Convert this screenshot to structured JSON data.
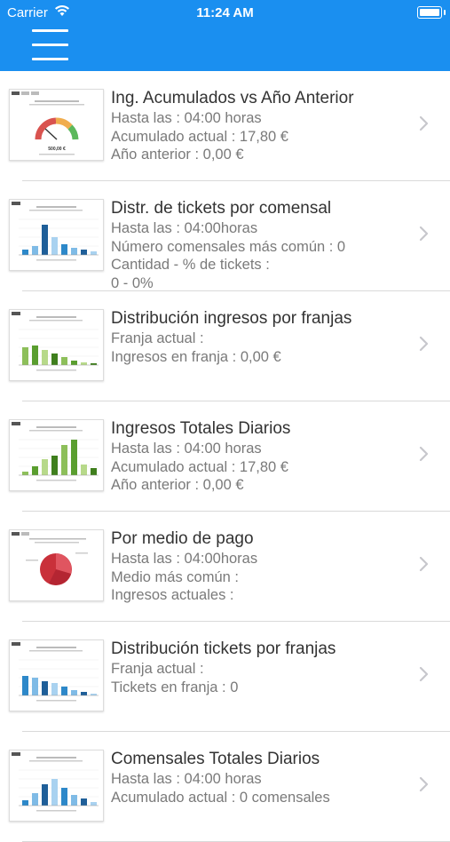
{
  "status_bar": {
    "carrier": "Carrier",
    "time": "11:24 AM"
  },
  "nav": {
    "menu_icon": "hamburger-menu-icon",
    "background_color": "#1a8ff0"
  },
  "reports": [
    {
      "title": "Ing. Acumulados vs Año Anterior",
      "lines": [
        "Hasta las  : 04:00 horas",
        "Acumulado actual : 17,80 €",
        "Año anterior : 0,00 €"
      ],
      "thumbnail": "gauge-chart",
      "thumbnail_value": "500,00 €"
    },
    {
      "title": "Distr. de tickets por comensal",
      "lines": [
        "Hasta las  : 04:00horas",
        "Número comensales más común : 0",
        "Cantidad - % de tickets :",
        "0 - 0%"
      ],
      "thumbnail": "bar-chart-blue"
    },
    {
      "title": "Distribución ingresos por franjas",
      "lines": [
        "Franja actual :",
        "Ingresos en franja : 0,00 €"
      ],
      "thumbnail": "bar-chart-green"
    },
    {
      "title": "Ingresos Totales Diarios",
      "lines": [
        "Hasta las  : 04:00 horas",
        "Acumulado actual : 17,80 €",
        "Año anterior : 0,00 €"
      ],
      "thumbnail": "bar-chart-green"
    },
    {
      "title": "Por medio de pago",
      "lines": [
        "Hasta las  : 04:00horas",
        "Medio más común :",
        "Ingresos actuales :"
      ],
      "thumbnail": "pie-chart-red"
    },
    {
      "title": "Distribución tickets por franjas",
      "lines": [
        "Franja actual :",
        "Tickets en franja : 0"
      ],
      "thumbnail": "bar-chart-blue"
    },
    {
      "title": "Comensales Totales Diarios",
      "lines": [
        "Hasta las  : 04:00 horas",
        "Acumulado actual : 0 comensales"
      ],
      "thumbnail": "bar-chart-blue"
    }
  ]
}
